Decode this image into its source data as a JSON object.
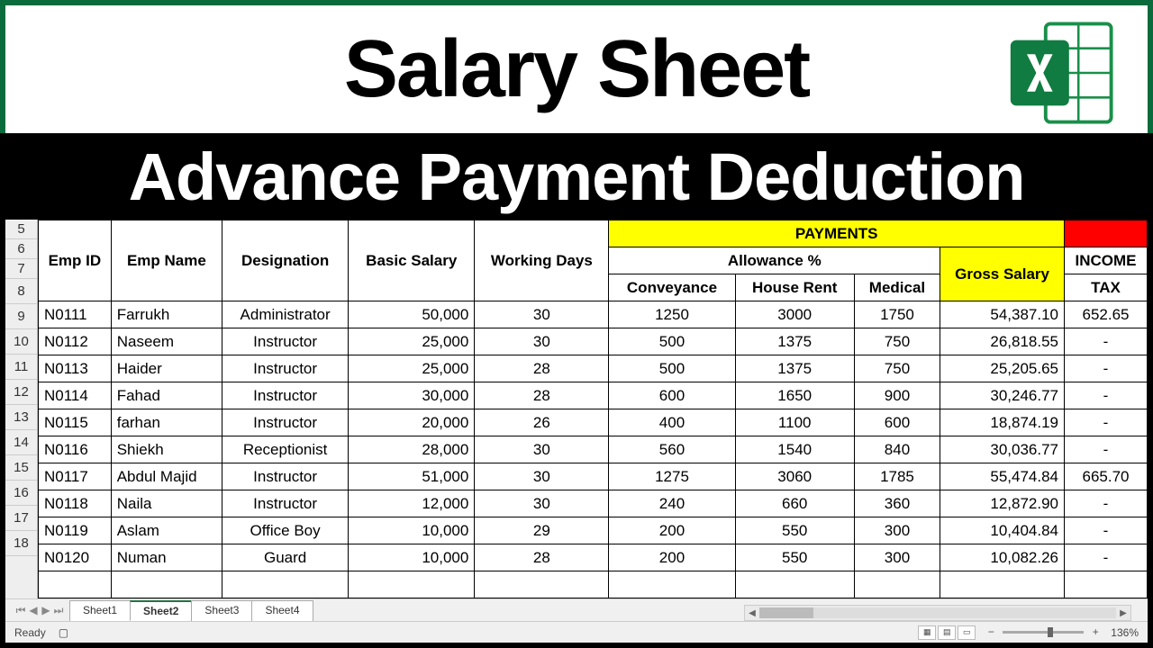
{
  "banner": {
    "title": "Salary Sheet",
    "subtitle": "Advance Payment Deduction"
  },
  "row_numbers": [
    "5",
    "6",
    "7",
    "8",
    "9",
    "10",
    "11",
    "12",
    "13",
    "14",
    "15",
    "16",
    "17",
    "18"
  ],
  "headers": {
    "emp_id": "Emp ID",
    "emp_name": "Emp Name",
    "designation": "Designation",
    "basic_salary": "Basic Salary",
    "working_days": "Working Days",
    "payments": "PAYMENTS",
    "allowance": "Allowance %",
    "conveyance": "Conveyance",
    "house_rent": "House Rent",
    "medical": "Medical",
    "gross_salary": "Gross Salary",
    "income_tax_1": "INCOME",
    "income_tax_2": "TAX"
  },
  "rows": [
    {
      "id": "N0111",
      "name": "Farrukh",
      "desig": "Administrator",
      "basic": "50,000",
      "days": "30",
      "conv": "1250",
      "rent": "3000",
      "med": "1750",
      "gross": "54,387.10",
      "tax": "652.65"
    },
    {
      "id": "N0112",
      "name": "Naseem",
      "desig": "Instructor",
      "basic": "25,000",
      "days": "30",
      "conv": "500",
      "rent": "1375",
      "med": "750",
      "gross": "26,818.55",
      "tax": "-"
    },
    {
      "id": "N0113",
      "name": "Haider",
      "desig": "Instructor",
      "basic": "25,000",
      "days": "28",
      "conv": "500",
      "rent": "1375",
      "med": "750",
      "gross": "25,205.65",
      "tax": "-"
    },
    {
      "id": "N0114",
      "name": "Fahad",
      "desig": "Instructor",
      "basic": "30,000",
      "days": "28",
      "conv": "600",
      "rent": "1650",
      "med": "900",
      "gross": "30,246.77",
      "tax": "-"
    },
    {
      "id": "N0115",
      "name": "farhan",
      "desig": "Instructor",
      "basic": "20,000",
      "days": "26",
      "conv": "400",
      "rent": "1100",
      "med": "600",
      "gross": "18,874.19",
      "tax": "-"
    },
    {
      "id": "N0116",
      "name": "Shiekh",
      "desig": "Receptionist",
      "basic": "28,000",
      "days": "30",
      "conv": "560",
      "rent": "1540",
      "med": "840",
      "gross": "30,036.77",
      "tax": "-"
    },
    {
      "id": "N0117",
      "name": "Abdul Majid",
      "desig": "Instructor",
      "basic": "51,000",
      "days": "30",
      "conv": "1275",
      "rent": "3060",
      "med": "1785",
      "gross": "55,474.84",
      "tax": "665.70"
    },
    {
      "id": "N0118",
      "name": "Naila",
      "desig": "Instructor",
      "basic": "12,000",
      "days": "30",
      "conv": "240",
      "rent": "660",
      "med": "360",
      "gross": "12,872.90",
      "tax": "-"
    },
    {
      "id": "N0119",
      "name": "Aslam",
      "desig": "Office Boy",
      "basic": "10,000",
      "days": "29",
      "conv": "200",
      "rent": "550",
      "med": "300",
      "gross": "10,404.84",
      "tax": "-"
    },
    {
      "id": "N0120",
      "name": "Numan",
      "desig": "Guard",
      "basic": "10,000",
      "days": "28",
      "conv": "200",
      "rent": "550",
      "med": "300",
      "gross": "10,082.26",
      "tax": "-"
    }
  ],
  "tabs": {
    "items": [
      "Sheet1",
      "Sheet2",
      "Sheet3",
      "Sheet4"
    ],
    "active_index": 1
  },
  "status": {
    "ready": "Ready",
    "zoom": "136%"
  }
}
